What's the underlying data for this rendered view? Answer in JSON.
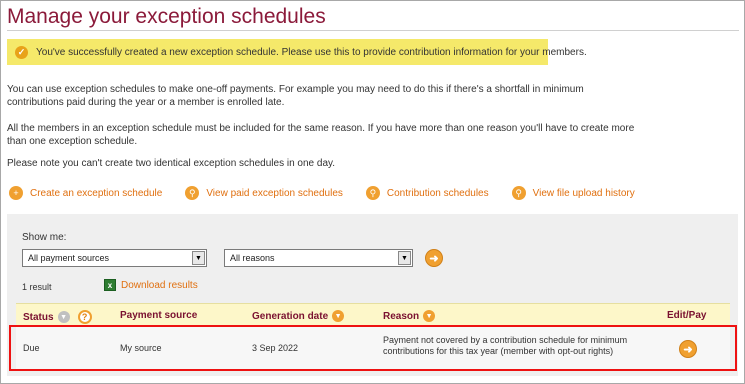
{
  "page": {
    "title": "Manage your exception schedules"
  },
  "success_message": "You've successfully created a new exception schedule. Please use this to provide contribution information for your members.",
  "info": {
    "para1_line1": "You can use exception schedules to make one-off payments. For example you may need to do this if there's a shortfall in minimum",
    "para1_line2": "contributions paid during the year or a member is enrolled late.",
    "para2_line1": "All the members in an exception schedule must be included for the same reason. If you have more than one reason you'll have to create more",
    "para2_line2": "than one exception schedule.",
    "para3": "Please note you can't create two identical exception schedules in one day."
  },
  "actions": [
    {
      "label": "Create an exception schedule",
      "icon": "plus-icon"
    },
    {
      "label": "View paid exception schedules",
      "icon": "magnifier-icon"
    },
    {
      "label": "Contribution schedules",
      "icon": "magnifier-icon"
    },
    {
      "label": "View file upload history",
      "icon": "magnifier-icon"
    }
  ],
  "filters": {
    "show_me_label": "Show me:",
    "payment_source": "All payment sources",
    "reason": "All reasons"
  },
  "results": {
    "count": "1 result",
    "download_label": "Download results"
  },
  "table": {
    "headers": {
      "status": "Status",
      "payment_source": "Payment source",
      "generation_date": "Generation date",
      "reason": "Reason",
      "edit_pay": "Edit/Pay"
    },
    "rows": [
      {
        "status": "Due",
        "payment_source": "My source",
        "generation_date": "3 Sep 2022",
        "reason_line1": "Payment not covered by a contribution schedule for minimum",
        "reason_line2": "contributions for this tax year (member with opt-out rights)"
      }
    ]
  },
  "colors": {
    "title": "#8b1a3a",
    "accent": "#f0a030",
    "link": "#e07010",
    "success_bg": "#f5e96a",
    "header_bg": "#fdf7c9",
    "highlight": "#ee1111"
  }
}
